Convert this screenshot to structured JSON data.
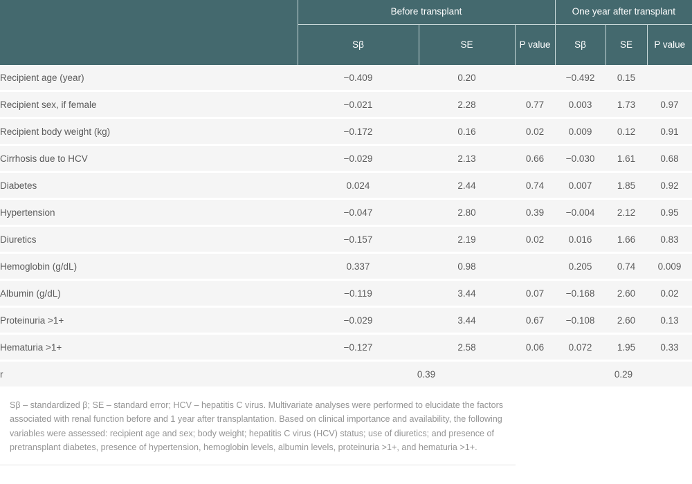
{
  "table": {
    "header": {
      "row_label_col": "",
      "groups": [
        {
          "label": "Before transplant",
          "span": 3
        },
        {
          "label": "One year after transplant",
          "span": 3
        }
      ],
      "subcolumns": [
        "Sβ",
        "SE",
        "P value",
        "Sβ",
        "SE",
        "P value"
      ]
    },
    "rows": [
      {
        "label": "Recipient age (year)",
        "before": {
          "sbeta": "−0.409",
          "se": "0.20",
          "p": ""
        },
        "after": {
          "sbeta": "−0.492",
          "se": "0.15",
          "p": ""
        }
      },
      {
        "label": "Recipient sex, if female",
        "before": {
          "sbeta": "−0.021",
          "se": "2.28",
          "p": "0.77"
        },
        "after": {
          "sbeta": "0.003",
          "se": "1.73",
          "p": "0.97"
        }
      },
      {
        "label": "Recipient body weight (kg)",
        "before": {
          "sbeta": "−0.172",
          "se": "0.16",
          "p": "0.02"
        },
        "after": {
          "sbeta": "0.009",
          "se": "0.12",
          "p": "0.91"
        }
      },
      {
        "label": "Cirrhosis due to HCV",
        "before": {
          "sbeta": "−0.029",
          "se": "2.13",
          "p": "0.66"
        },
        "after": {
          "sbeta": "−0.030",
          "se": "1.61",
          "p": "0.68"
        }
      },
      {
        "label": "Diabetes",
        "before": {
          "sbeta": "0.024",
          "se": "2.44",
          "p": "0.74"
        },
        "after": {
          "sbeta": "0.007",
          "se": "1.85",
          "p": "0.92"
        }
      },
      {
        "label": "Hypertension",
        "before": {
          "sbeta": "−0.047",
          "se": "2.80",
          "p": "0.39"
        },
        "after": {
          "sbeta": "−0.004",
          "se": "2.12",
          "p": "0.95"
        }
      },
      {
        "label": "Diuretics",
        "before": {
          "sbeta": "−0.157",
          "se": "2.19",
          "p": "0.02"
        },
        "after": {
          "sbeta": "0.016",
          "se": "1.66",
          "p": "0.83"
        }
      },
      {
        "label": "Hemoglobin (g/dL)",
        "before": {
          "sbeta": "0.337",
          "se": "0.98",
          "p": ""
        },
        "after": {
          "sbeta": "0.205",
          "se": "0.74",
          "p": "0.009"
        }
      },
      {
        "label": "Albumin (g/dL)",
        "before": {
          "sbeta": "−0.119",
          "se": "3.44",
          "p": "0.07"
        },
        "after": {
          "sbeta": "−0.168",
          "se": "2.60",
          "p": "0.02"
        }
      },
      {
        "label": "Proteinuria >1+",
        "before": {
          "sbeta": "−0.029",
          "se": "3.44",
          "p": "0.67"
        },
        "after": {
          "sbeta": "−0.108",
          "se": "2.60",
          "p": "0.13"
        }
      },
      {
        "label": "Hematuria >1+",
        "before": {
          "sbeta": "−0.127",
          "se": "2.58",
          "p": "0.06"
        },
        "after": {
          "sbeta": "0.072",
          "se": "1.95",
          "p": "0.33"
        }
      }
    ],
    "summary_row": {
      "label": "r",
      "before_value": "0.39",
      "after_value": "0.29"
    }
  },
  "footnote": {
    "text": "Sβ – standardized β; SE – standard error; HCV – hepatitis C virus. Multivariate analyses were performed to elucidate the factors associated with renal function before and 1 year after transplantation. Based on clinical importance and availability, the following variables were assessed: recipient age and sex; body weight; hepatitis C virus (HCV) status; use of diuretics; and presence of pretransplant diabetes, presence of hypertension, hemoglobin levels, albumin levels, proteinuria >1+, and hematuria >1+."
  },
  "colors": {
    "header_background": "#44696e",
    "header_text": "#ffffff",
    "row_background": "#f5f5f5",
    "row_divider": "#ffffff",
    "body_text": "#5b5b5b",
    "footnote_text": "#949494"
  }
}
